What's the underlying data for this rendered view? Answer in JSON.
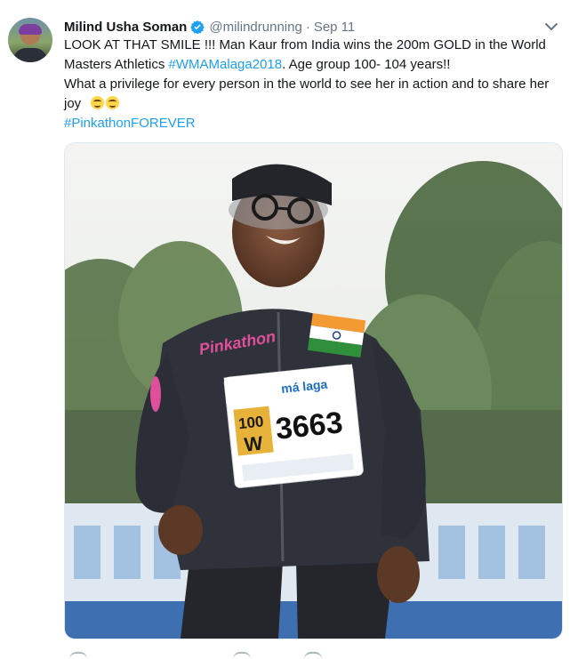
{
  "tweet": {
    "author_name": "Milind Usha Soman",
    "handle": "@milindrunning",
    "separator": "·",
    "time": "Sep 11",
    "line1_text": "LOOK AT THAT SMILE !!! Man Kaur from India wins the 200m GOLD in the World Masters Athletics ",
    "hashtag1": "#WMAMalaga2018",
    "line1_tail": ". Age group 100- 104 years!!",
    "line2_text": "What a privilege for every person in the world to see her in action and to share her joy",
    "hashtag2": "#PinkathonFOREVER"
  },
  "photo": {
    "bib_category": "100",
    "bib_letter": "W",
    "bib_number": "3663",
    "bib_brand": "má laga",
    "jacket_logo": "Pinkathon"
  },
  "colors": {
    "link": "#1da1f2",
    "verified": "#1da1f2",
    "muted": "#657786"
  },
  "icons": [
    "verified-badge-icon",
    "chevron-down-icon",
    "smiling-face-emoji-icon"
  ]
}
